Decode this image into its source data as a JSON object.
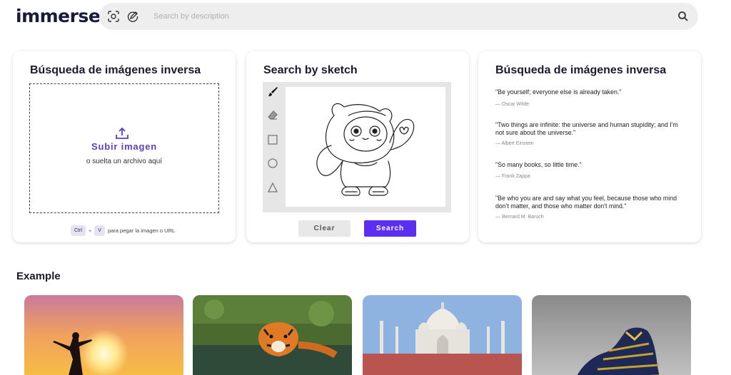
{
  "header": {
    "logo": "immerse",
    "search_placeholder": "Search by description"
  },
  "upload_card": {
    "title": "Búsqueda de imágenes inversa",
    "upload_label": "Subir imagen",
    "drop_hint": "o suelta un archivo aquí",
    "key_ctrl": "Ctrl",
    "key_plus": "+",
    "key_v": "V",
    "paste_hint": "para pegar la imagen o URL"
  },
  "sketch_card": {
    "title": "Search by sketch",
    "clear_label": "Clear",
    "search_label": "Search"
  },
  "quotes_card": {
    "title": "Búsqueda de imágenes inversa",
    "quotes": [
      {
        "text": "\"Be yourself; everyone else is already taken.\"",
        "author": "— Oscar Wilde"
      },
      {
        "text": "\"Two things are infinite: the universe and human stupidity; and I'm not sure about the universe.\"",
        "author": "— Albert Einstein"
      },
      {
        "text": "\"So many books, so little time.\"",
        "author": "— Frank Zappa"
      },
      {
        "text": "\"Be who you are and say what you feel, because those who mind don't matter, and those who matter don't mind.\"",
        "author": "— Bernard M. Baruch"
      }
    ]
  },
  "example": {
    "title": "Example"
  },
  "colors": {
    "accent": "#5c2ef0",
    "upload_text": "#5b3fc4",
    "logo": "#1a1a3d"
  },
  "icons": [
    "camera-scan-icon",
    "sketch-icon",
    "search-icon",
    "upload-icon",
    "brush-icon",
    "eraser-icon",
    "square-icon",
    "circle-icon",
    "triangle-icon"
  ]
}
